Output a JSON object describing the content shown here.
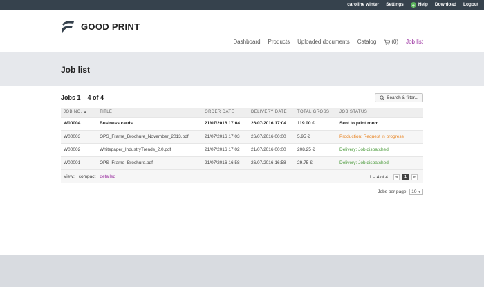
{
  "topbar": {
    "user": "caroline winter",
    "settings": "Settings",
    "help": "Help",
    "help_glyph": "?",
    "download": "Download",
    "logout": "Logout"
  },
  "logo": {
    "text": "GOOD PRINT"
  },
  "nav": {
    "dashboard": "Dashboard",
    "products": "Products",
    "uploaded_documents": "Uploaded documents",
    "catalog": "Catalog",
    "cart_count": "(0)",
    "job_list": "Job list"
  },
  "page": {
    "title": "Job list"
  },
  "jobs": {
    "heading": "Jobs 1 – 4 of 4",
    "search_label": "Search & filter...",
    "columns": {
      "job_no": "JOB NO.",
      "sort_glyph": "▲",
      "title": "TITLE",
      "order_date": "ORDER DATE",
      "delivery_date": "DELIVERY DATE",
      "total_gross": "TOTAL GROSS",
      "job_status": "JOB STATUS"
    },
    "rows": [
      {
        "job_no": "W00004",
        "title": "Business cards",
        "order_date": "21/07/2016 17:04",
        "delivery_date": "26/07/2016 17:04",
        "total_gross": "119.00 €",
        "status": "Sent to print room"
      },
      {
        "job_no": "W00003",
        "title": "OPS_Frame_Brochure_November_2013.pdf",
        "order_date": "21/07/2016 17:03",
        "delivery_date": "26/07/2016 00:00",
        "total_gross": "5.95 €",
        "status": "Production: Request in progress"
      },
      {
        "job_no": "W00002",
        "title": "Whitepaper_IndustryTrends_2.0.pdf",
        "order_date": "21/07/2016 17:02",
        "delivery_date": "21/07/2016 00:00",
        "total_gross": "208.25 €",
        "status": "Delivery: Job dispatched"
      },
      {
        "job_no": "W00001",
        "title": "OPS_Frame_Brochure.pdf",
        "order_date": "21/07/2016 16:58",
        "delivery_date": "26/07/2016 16:58",
        "total_gross": "29.75 €",
        "status": "Delivery: Job dispatched"
      }
    ],
    "view_label": "View:",
    "view_compact": "compact",
    "view_detailed": "detailed",
    "range": "1 – 4 of 4",
    "current_page": "1",
    "per_page_label": "Jobs per page:",
    "per_page_value": "10",
    "prev_glyph": "◀",
    "next_glyph": "▶",
    "dropdown_glyph": "▼"
  },
  "colors": {
    "topbar": "#36424d",
    "accent": "#9a2fa0",
    "production": "#e8821e",
    "delivery": "#4a9a3a",
    "band": "#e6e8ec"
  }
}
